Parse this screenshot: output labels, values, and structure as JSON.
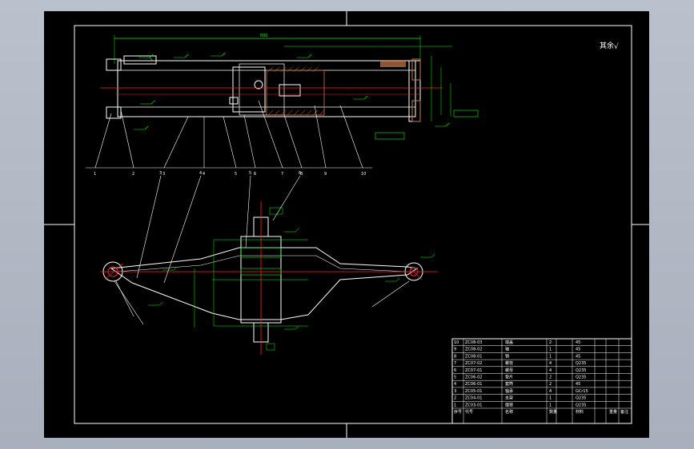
{
  "colors": {
    "background": "#000000",
    "border": "#ffffff",
    "part": "#ffffff",
    "centerline": "#ff2020",
    "dimension": "#00ff00",
    "hatch": "#cc7a4a",
    "annotation": "#00ffff",
    "leader": "#ffffff"
  },
  "top_view": {
    "overall_dimension": "800",
    "balloons": [
      "1",
      "2",
      "3",
      "4",
      "5",
      "6",
      "7",
      "8",
      "9",
      "10"
    ]
  },
  "bottom_view": {
    "balloons": [
      "1",
      "2",
      "3",
      "4",
      "5",
      "6",
      "7",
      "8"
    ]
  },
  "roughness": {
    "symbol": "√",
    "label": "其余"
  },
  "title_block": {
    "rows": [
      {
        "index": "10",
        "code": "ZC08-03",
        "name": "端盖",
        "qty": "2",
        "material": "45"
      },
      {
        "index": "9",
        "code": "ZC08-02",
        "name": "轴",
        "qty": "1",
        "material": "45"
      },
      {
        "index": "8",
        "code": "ZC08-01",
        "name": "销",
        "qty": "1",
        "material": "45"
      },
      {
        "index": "7",
        "code": "ZC07-02",
        "name": "螺栓",
        "qty": "4",
        "material": "Q235"
      },
      {
        "index": "6",
        "code": "ZC07-01",
        "name": "螺母",
        "qty": "4",
        "material": "Q235"
      },
      {
        "index": "5",
        "code": "ZC06-02",
        "name": "垫片",
        "qty": "2",
        "material": "Q235"
      },
      {
        "index": "4",
        "code": "ZC06-01",
        "name": "套筒",
        "qty": "2",
        "material": "45"
      },
      {
        "index": "3",
        "code": "ZC05-01",
        "name": "轴承",
        "qty": "4",
        "material": "GCr15"
      },
      {
        "index": "2",
        "code": "ZC04-01",
        "name": "支架",
        "qty": "1",
        "material": "Q235"
      },
      {
        "index": "1",
        "code": "ZC03-01",
        "name": "摆臂",
        "qty": "1",
        "material": "Q235"
      }
    ],
    "header": {
      "index": "序号",
      "code": "代号",
      "name": "名称",
      "qty": "数量",
      "material": "材料",
      "weight": "重量",
      "remark": "备注"
    }
  }
}
